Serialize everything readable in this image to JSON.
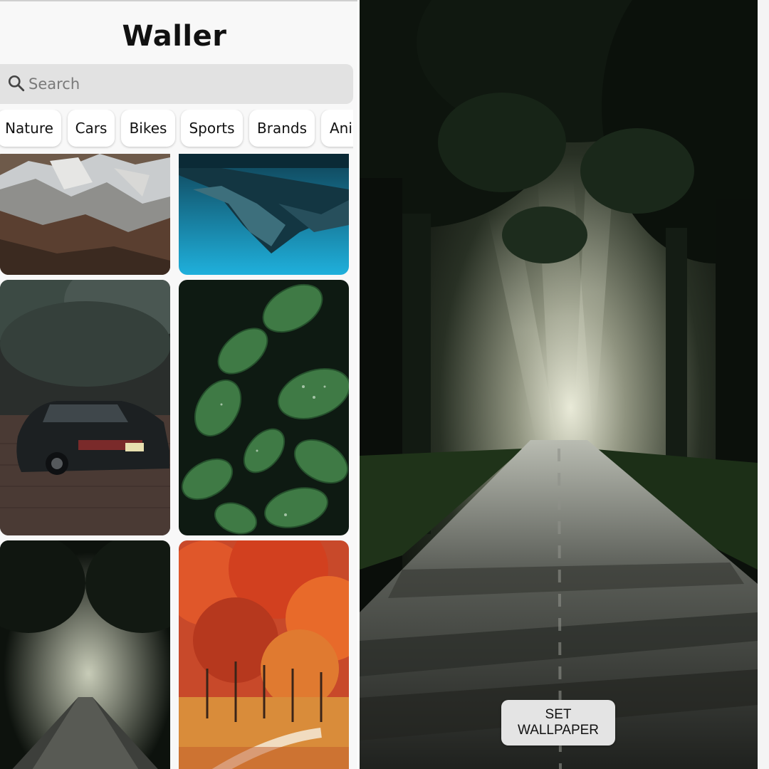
{
  "app": {
    "title": "Waller"
  },
  "search": {
    "placeholder": "Search",
    "icon": "search-icon"
  },
  "categories": [
    "Nature",
    "Cars",
    "Bikes",
    "Sports",
    "Brands",
    "Ani"
  ],
  "wallpapers": [
    {
      "subject": "snowy mountains"
    },
    {
      "subject": "blue lake reflection"
    },
    {
      "subject": "black sports car"
    },
    {
      "subject": "green leaves with dew"
    },
    {
      "subject": "sunlit forest road"
    },
    {
      "subject": "red autumn trees"
    }
  ],
  "preview": {
    "set_wallpaper_label": "SET WALLPAPER"
  },
  "colors": {
    "background": "#f8f8f8",
    "search_bg": "#e2e2e2",
    "chip_bg": "#ffffff",
    "button_bg": "#e4e4e4"
  }
}
